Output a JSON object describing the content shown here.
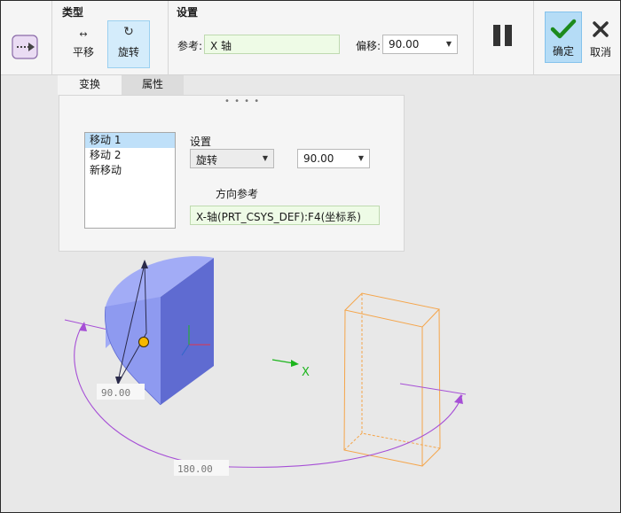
{
  "toolbar": {
    "type_group_title": "类型",
    "translate_label": "平移",
    "rotate_label": "旋转",
    "settings_group_title": "设置",
    "reference_label": "参考:",
    "reference_value": "X 轴",
    "offset_label": "偏移:",
    "offset_value": "90.00",
    "ok_label": "确定",
    "cancel_label": "取消"
  },
  "tabs": [
    {
      "label": "变换",
      "active": true
    },
    {
      "label": "属性",
      "active": false
    }
  ],
  "panel": {
    "moves": [
      {
        "label": "移动 1",
        "selected": true
      },
      {
        "label": "移动 2",
        "selected": false
      },
      {
        "label": "新移动",
        "selected": false
      }
    ],
    "settings_label": "设置",
    "motion_type": "旋转",
    "angle_value": "90.00",
    "direction_ref_label": "方向参考",
    "direction_ref_value": "X-轴(PRT_CSYS_DEF):F4(坐标系)"
  },
  "viewport": {
    "axis_label": "X",
    "dimension_90": "90.00",
    "dimension_180": "180.00"
  },
  "colors": {
    "accent_selected": "#bfe0f9",
    "ok_button": "#b5dcf6",
    "green_field": "#eefbe6",
    "part_fill": "#8e9af0",
    "preview_outline": "#f5a54a",
    "dimension_arc": "#a64fd6",
    "axis_green": "#1db51d"
  },
  "icons": {
    "dashboard": "dashboard-arrow-icon",
    "translate": "translate-arrows-icon",
    "rotate": "rotate-icon",
    "pause": "pause-icon",
    "ok": "checkmark-icon",
    "cancel": "close-icon"
  }
}
